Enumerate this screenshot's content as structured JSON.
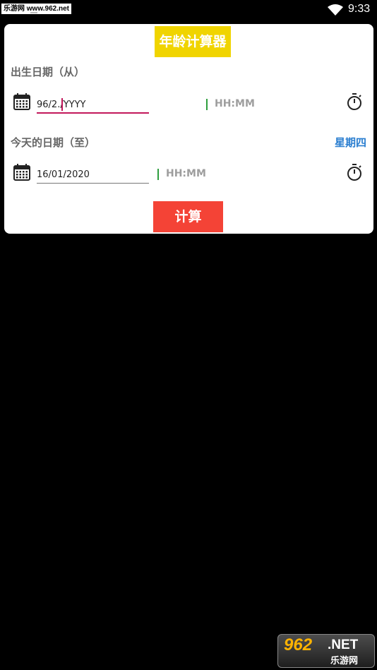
{
  "status_bar": {
    "watermark": "乐游网 www.962.net",
    "time": "9:33"
  },
  "app": {
    "title": "年龄计算器",
    "birth_label": "出生日期（从）",
    "birth_date_value": "96/2./YYYY",
    "birth_time_placeholder": "HH:MM",
    "today_label": "今天的日期（至）",
    "weekday": "星期四",
    "today_date_value": "16/01/2020",
    "today_time_placeholder": "HH:MM",
    "calculate_label": "计算"
  },
  "watermark_bottom": {
    "brand": "962",
    "net": ".NET",
    "sub": "乐游网"
  },
  "colors": {
    "title_bg": "#f0d400",
    "button_bg": "#f44336",
    "focus_line": "#c2185b",
    "weekday": "#2a7ed0",
    "time_bar": "#2e9e3e"
  },
  "icons": [
    "calendar-icon",
    "stopwatch-icon",
    "wifi-icon"
  ]
}
